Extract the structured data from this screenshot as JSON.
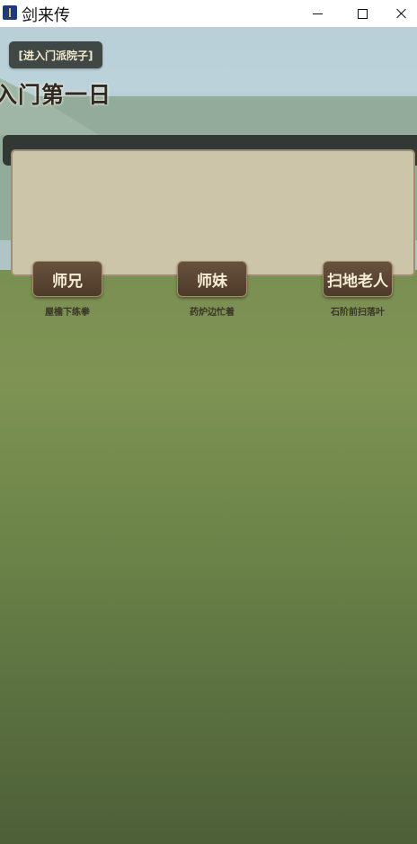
{
  "window": {
    "title": "剑来传",
    "icon": "app-icon",
    "controls": [
      "minimize-icon",
      "maximize-icon",
      "close-icon"
    ]
  },
  "scene": {
    "location_label": "[进入门派院子]",
    "day_title": "入门第一日",
    "dialog_text": "",
    "npcs": [
      {
        "name": "师兄",
        "description": "屋檐下练拳"
      },
      {
        "name": "师妹",
        "description": "药炉边忙着"
      },
      {
        "name": "扫地老人",
        "description": "石阶前扫落叶"
      }
    ]
  },
  "colors": {
    "npc_button": "#5a4533",
    "dialog_panel": "#cdc5aa",
    "ground": "#7a8f52"
  }
}
